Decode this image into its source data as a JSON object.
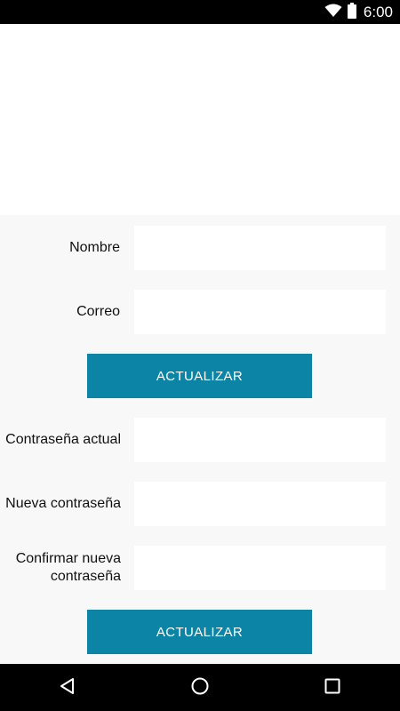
{
  "status_bar": {
    "time": "6:00",
    "icons": [
      "wifi-icon",
      "battery-icon"
    ]
  },
  "profile_form": {
    "name_label": "Nombre",
    "name_value": "",
    "email_label": "Correo",
    "email_value": "",
    "update_label": "ACTUALIZAR"
  },
  "password_form": {
    "current_label": "Contraseña actual",
    "new_label": "Nueva contraseña",
    "confirm_label_line1": "Confirmar nueva",
    "confirm_label_line2": "contraseña",
    "update_label": "ACTUALIZAR"
  },
  "nav_bar": {
    "icons": [
      "back-icon",
      "home-icon",
      "recents-icon"
    ]
  },
  "colors": {
    "accent": "#0b84a5",
    "panel_bg": "#f8f8f8"
  }
}
